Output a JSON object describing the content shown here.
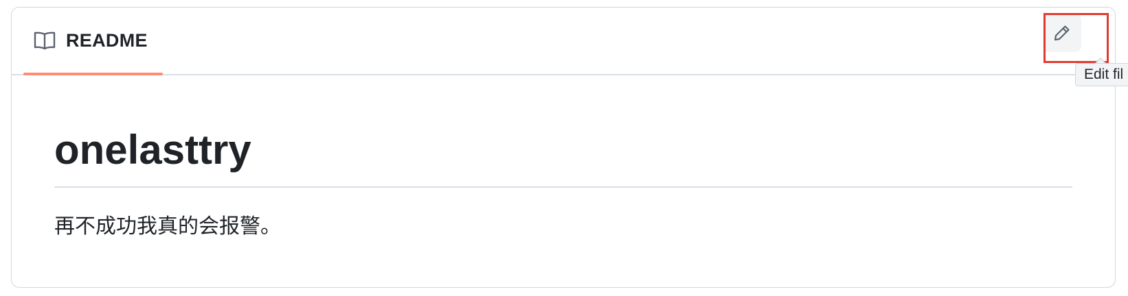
{
  "readme": {
    "tab": {
      "icon": "book-icon",
      "label": "README",
      "active": true,
      "underline_color": "#fd8c73"
    },
    "edit_button": {
      "icon": "pencil-icon",
      "tooltip": "Edit fil",
      "highlighted": true,
      "highlight_color": "#e03a2f"
    },
    "content": {
      "heading": "onelasttry",
      "paragraph": "再不成功我真的会报警。"
    }
  }
}
